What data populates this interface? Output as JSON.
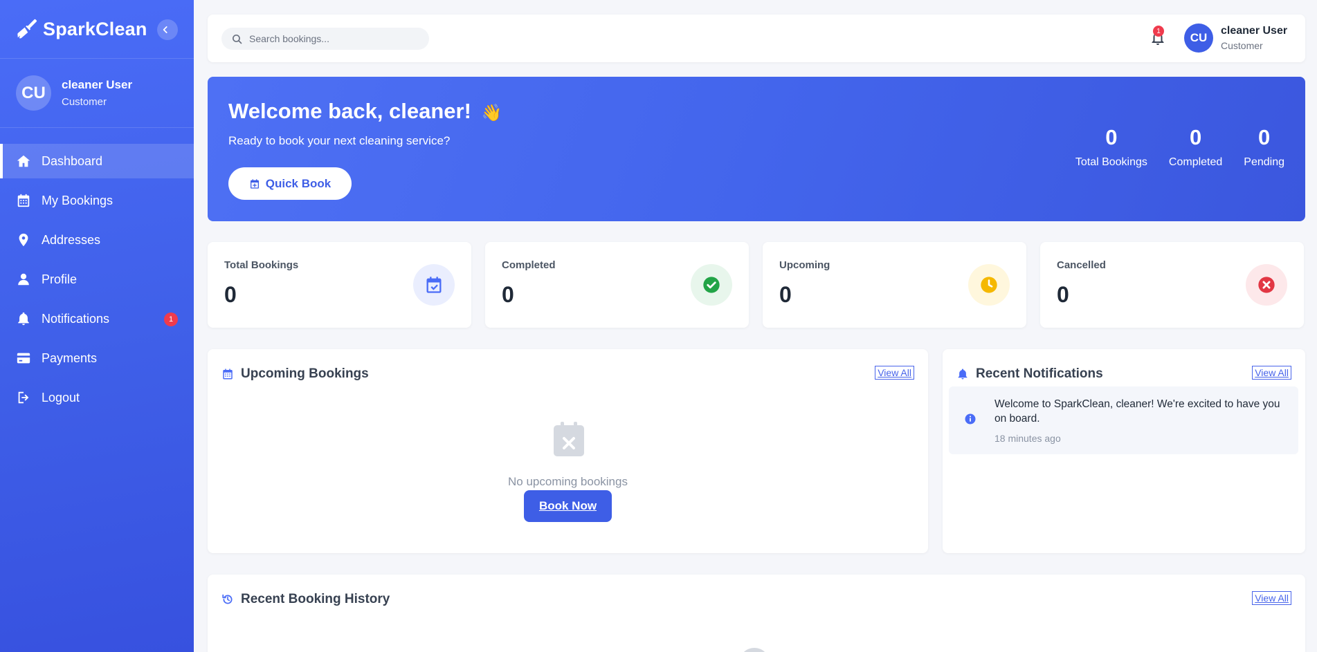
{
  "app": {
    "brand": "SparkClean",
    "colors": {
      "primary": "#4a6cf7",
      "success": "#22a447",
      "warning": "#f5b800",
      "danger": "#e23744",
      "badge": "#ef3b4d"
    }
  },
  "sidebar": {
    "user": {
      "initials": "CU",
      "name": "cleaner User",
      "role": "Customer"
    },
    "items": [
      {
        "label": "Dashboard",
        "icon": "home-icon",
        "active": true
      },
      {
        "label": "My Bookings",
        "icon": "calendar-icon"
      },
      {
        "label": "Addresses",
        "icon": "map-pin-icon"
      },
      {
        "label": "Profile",
        "icon": "user-icon"
      },
      {
        "label": "Notifications",
        "icon": "bell-icon",
        "badge": "1"
      },
      {
        "label": "Payments",
        "icon": "credit-card-icon"
      },
      {
        "label": "Logout",
        "icon": "logout-icon"
      }
    ]
  },
  "topbar": {
    "search_placeholder": "Search bookings...",
    "notification_count": "1",
    "user": {
      "initials": "CU",
      "name": "cleaner User",
      "role": "Customer"
    }
  },
  "hero": {
    "title": "Welcome back, cleaner!",
    "emoji": "👋",
    "subtitle": "Ready to book your next cleaning service?",
    "button": "Quick Book",
    "stats": [
      {
        "value": "0",
        "label": "Total Bookings"
      },
      {
        "value": "0",
        "label": "Completed"
      },
      {
        "value": "0",
        "label": "Pending"
      }
    ]
  },
  "stat_cards": [
    {
      "label": "Total Bookings",
      "value": "0",
      "icon": "calendar-check-icon"
    },
    {
      "label": "Completed",
      "value": "0",
      "icon": "check-circle-icon"
    },
    {
      "label": "Upcoming",
      "value": "0",
      "icon": "clock-icon"
    },
    {
      "label": "Cancelled",
      "value": "0",
      "icon": "x-circle-icon"
    }
  ],
  "upcoming": {
    "title": "Upcoming Bookings",
    "view_all": "View All",
    "empty_text": "No upcoming bookings",
    "button": "Book Now"
  },
  "notifications": {
    "title": "Recent Notifications",
    "view_all": "View All",
    "items": [
      {
        "text": "Welcome to SparkClean, cleaner! We're excited to have you on board.",
        "time": "18 minutes ago"
      }
    ]
  },
  "history": {
    "title": "Recent Booking History",
    "view_all": "View All"
  }
}
